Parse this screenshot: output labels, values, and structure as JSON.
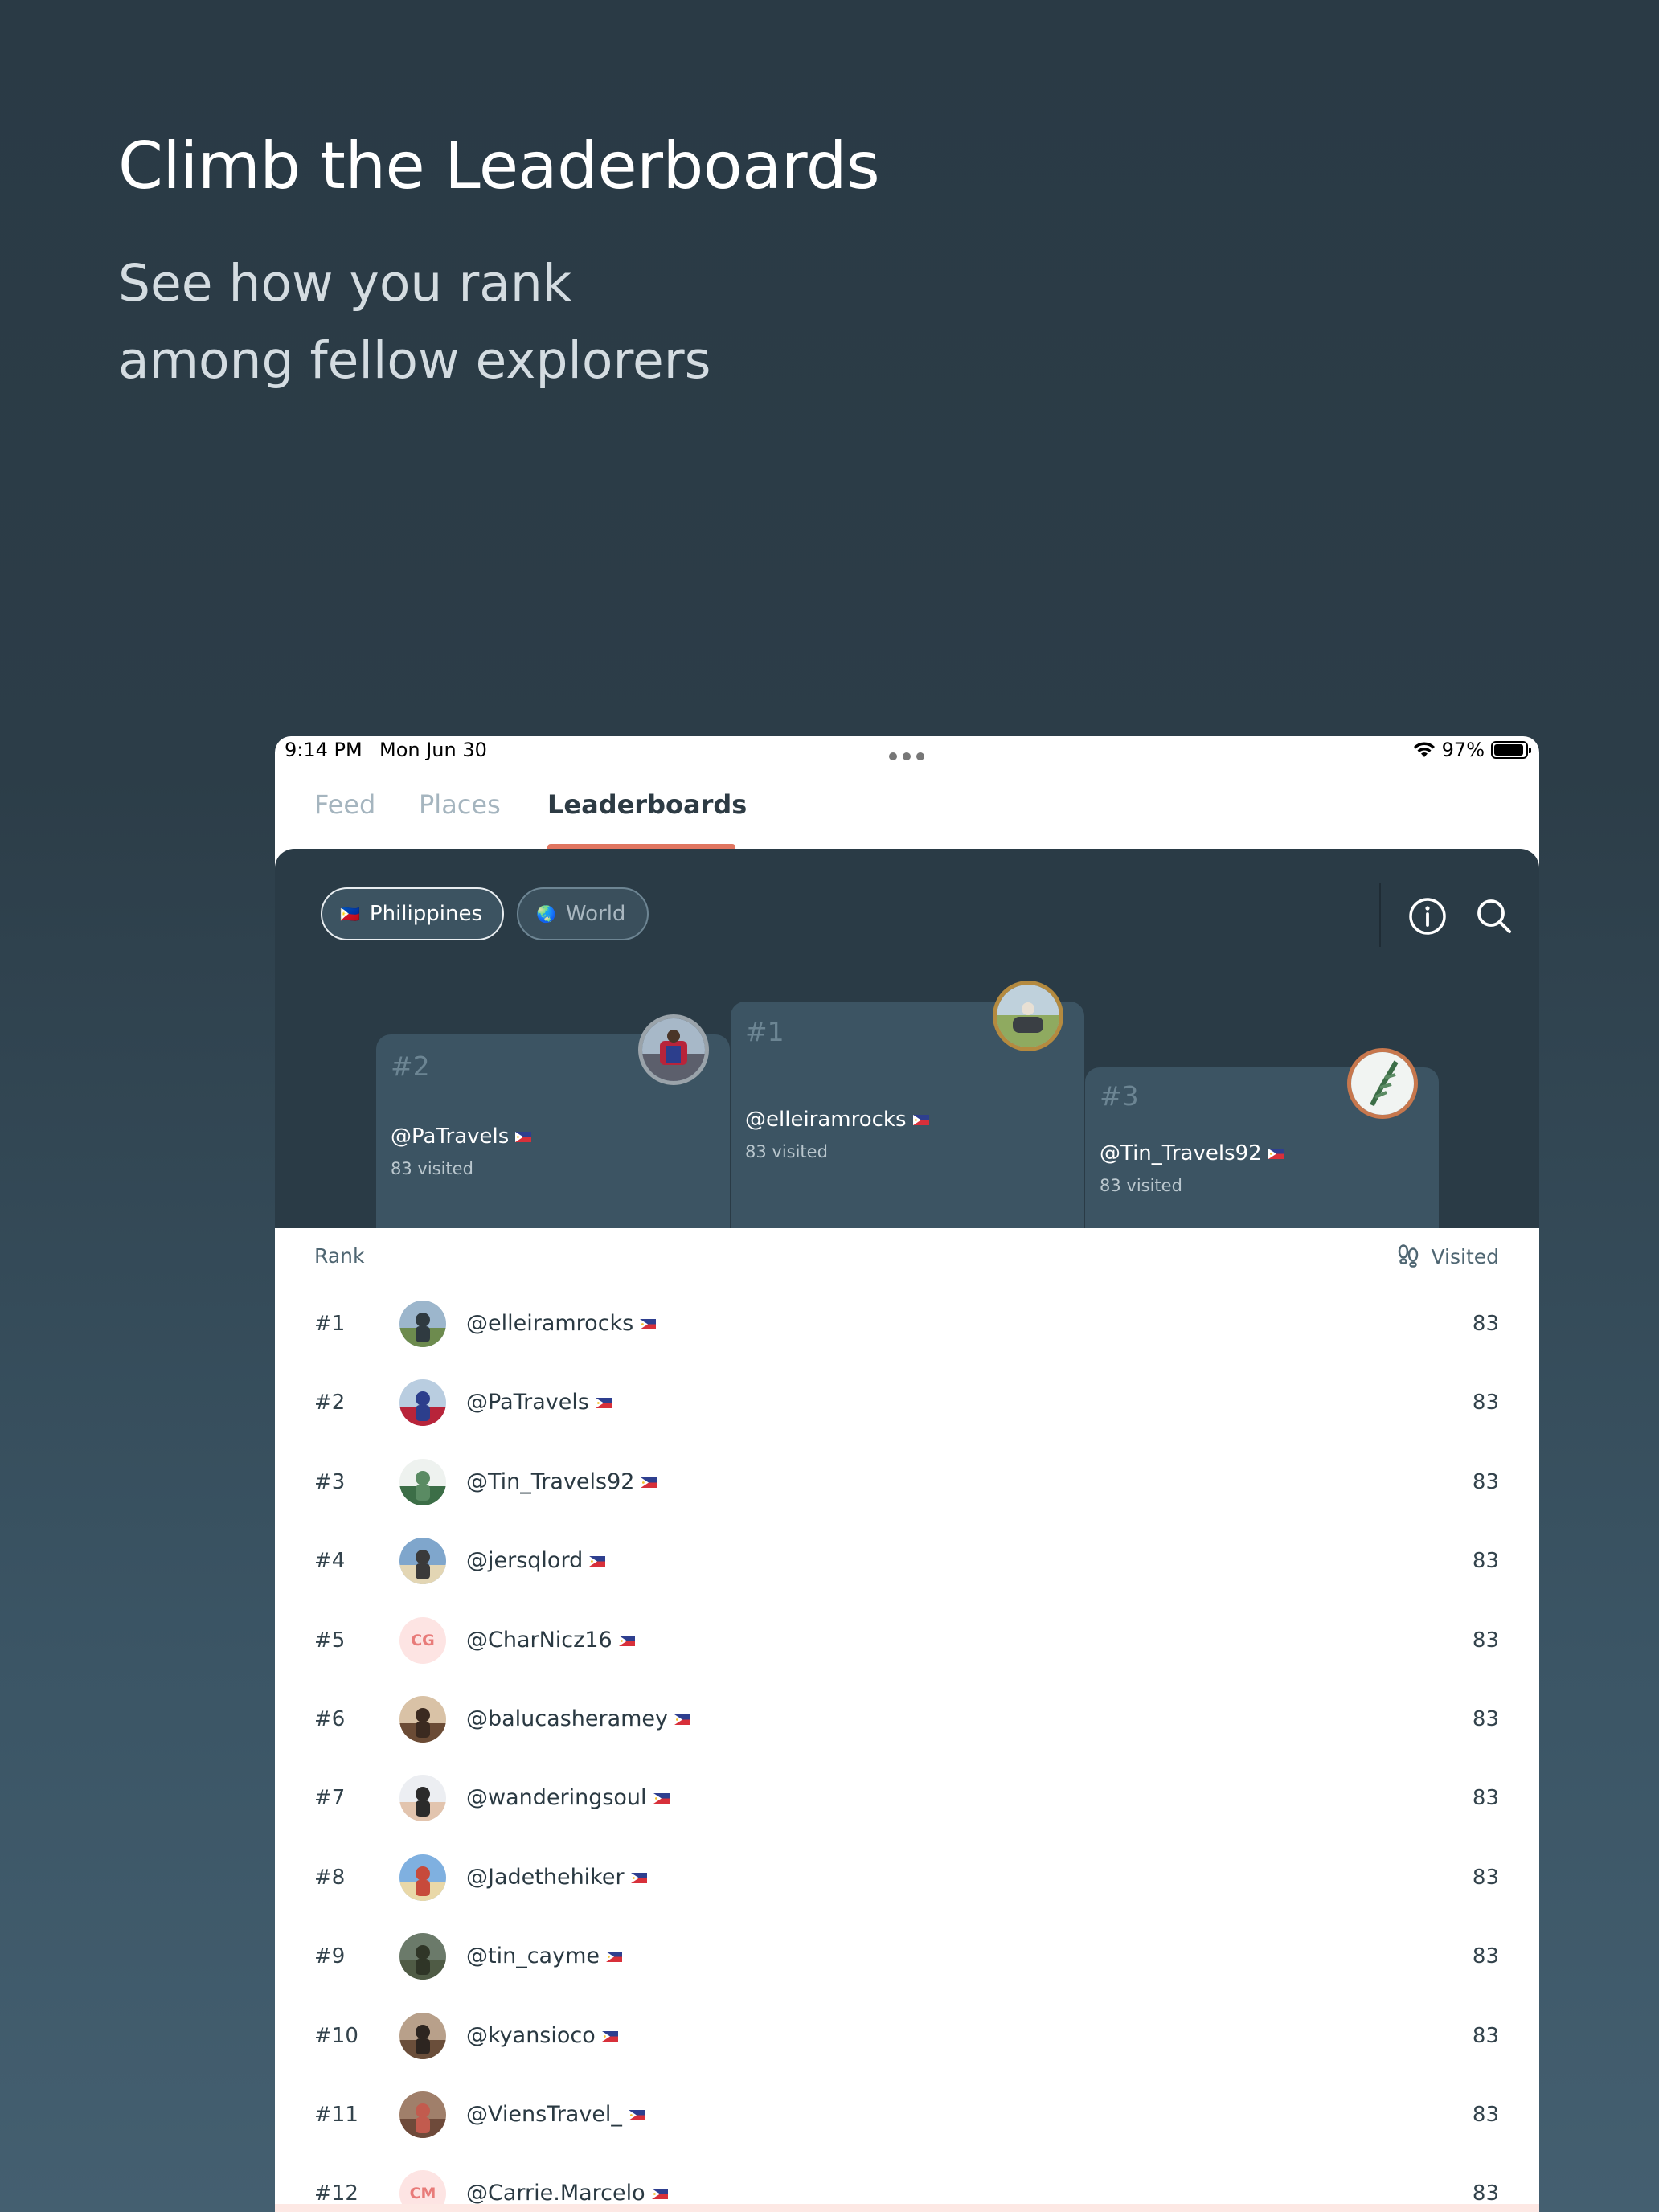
{
  "hero": {
    "title": "Climb the Leaderboards",
    "subtitle_line1": "See how you rank",
    "subtitle_line2": "among fellow explorers"
  },
  "status_bar": {
    "time": "9:14 PM",
    "date": "Mon Jun 30",
    "battery": "97%"
  },
  "tabs": [
    {
      "label": "Feed",
      "active": false
    },
    {
      "label": "Places",
      "active": false
    },
    {
      "label": "Leaderboards",
      "active": true
    }
  ],
  "filters": [
    {
      "label": "Philippines",
      "emoji": "🇵🇭",
      "selected": true
    },
    {
      "label": "World",
      "emoji": "🌏",
      "selected": false
    }
  ],
  "icons": {
    "info": "info-icon",
    "search": "search-icon",
    "visited": "footsteps-icon"
  },
  "podium": {
    "first": {
      "rank": "#1",
      "username": "@elleiramrocks",
      "visited": "83 visited"
    },
    "second": {
      "rank": "#2",
      "username": "@PaTravels",
      "visited": "83 visited"
    },
    "third": {
      "rank": "#3",
      "username": "@Tin_Travels92",
      "visited": "83 visited"
    }
  },
  "list_header": {
    "rank": "Rank",
    "visited": "Visited"
  },
  "rows": [
    {
      "rank": "#1",
      "username": "@elleiramrocks",
      "count": "83"
    },
    {
      "rank": "#2",
      "username": "@PaTravels",
      "count": "83"
    },
    {
      "rank": "#3",
      "username": "@Tin_Travels92",
      "count": "83"
    },
    {
      "rank": "#4",
      "username": "@jersqlord",
      "count": "83"
    },
    {
      "rank": "#5",
      "username": "@CharNicz16",
      "count": "83",
      "initials": "CG"
    },
    {
      "rank": "#6",
      "username": "@balucasheramey",
      "count": "83"
    },
    {
      "rank": "#7",
      "username": "@wanderingsoul",
      "count": "83"
    },
    {
      "rank": "#8",
      "username": "@Jadethehiker",
      "count": "83"
    },
    {
      "rank": "#9",
      "username": "@tin_cayme",
      "count": "83"
    },
    {
      "rank": "#10",
      "username": "@kyansioco",
      "count": "83"
    },
    {
      "rank": "#11",
      "username": "@ViensTravel_",
      "count": "83"
    },
    {
      "rank": "#12",
      "username": "@Carrie.Marcelo",
      "count": "83",
      "initials": "CM"
    }
  ],
  "colors": {
    "accent": "#e07560",
    "board_bg": "#2a3b46",
    "podium_bg": "#3c5463"
  }
}
